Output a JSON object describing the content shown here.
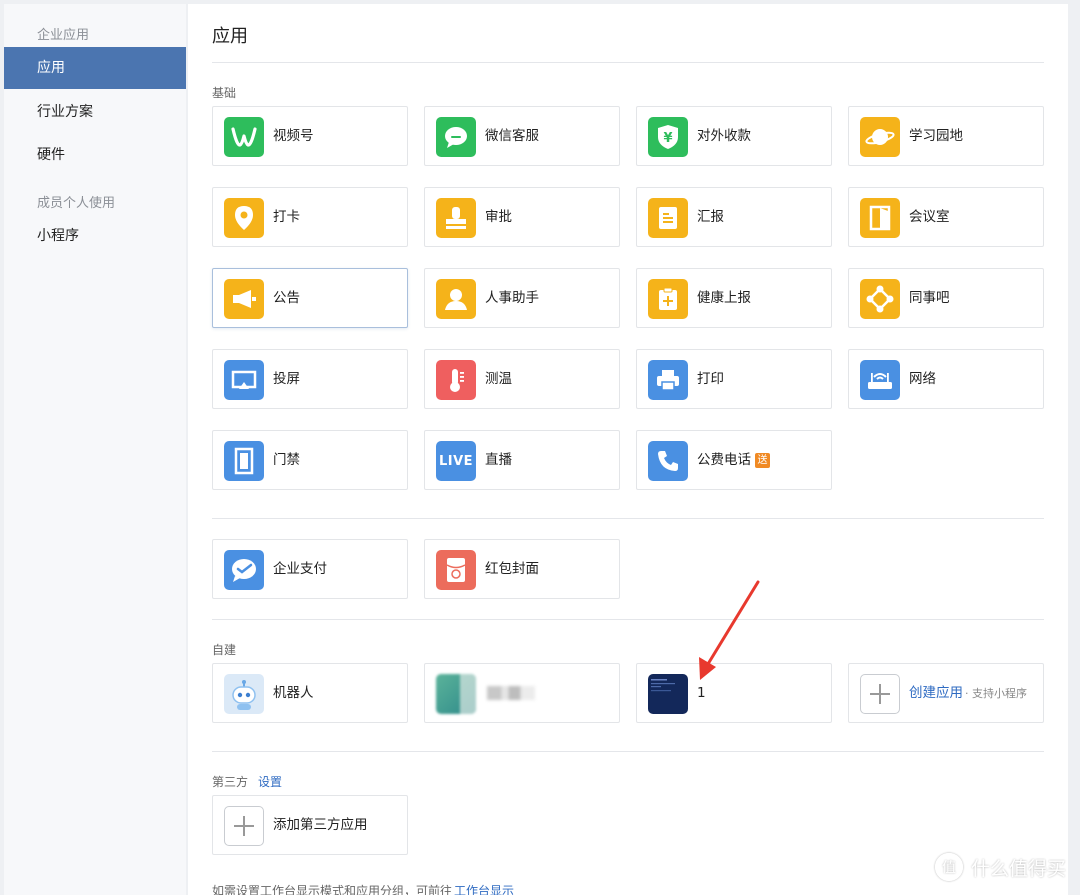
{
  "sidebar": {
    "group1": "企业应用",
    "items1": [
      "应用",
      "行业方案",
      "硬件"
    ],
    "group2": "成员个人使用",
    "items2": [
      "小程序"
    ]
  },
  "main": {
    "title": "应用",
    "section_basic": "基础",
    "basic_apps": [
      "视频号",
      "微信客服",
      "对外收款",
      "学习园地",
      "打卡",
      "审批",
      "汇报",
      "会议室",
      "公告",
      "人事助手",
      "健康上报",
      "同事吧",
      "投屏",
      "测温",
      "打印",
      "网络",
      "门禁",
      "直播",
      "公费电话"
    ],
    "phone_badge": "送",
    "live_icon_text": "LIVE",
    "finance_apps": [
      "企业支付",
      "红包封面"
    ],
    "section_custom": "自建",
    "custom_apps": {
      "robot": "机器人",
      "app1": "1",
      "create": "创建应用",
      "create_sub": "· 支持小程序"
    },
    "section_third": "第三方",
    "third_settings": "设置",
    "third_add": "添加第三方应用",
    "footnote": "如需设置工作台显示模式和应用分组，可前往",
    "footnote_link": "工作台显示"
  },
  "watermark": {
    "text": "什么值得买",
    "icon_glyph": "值"
  },
  "colors": {
    "accent": "#4b75b0",
    "green": "#2ebd5c",
    "yellow": "#f5b31a",
    "blue": "#4a90e2",
    "red": "#ef5f5f",
    "badge": "#f08a24",
    "annotation": "#e8392e"
  }
}
